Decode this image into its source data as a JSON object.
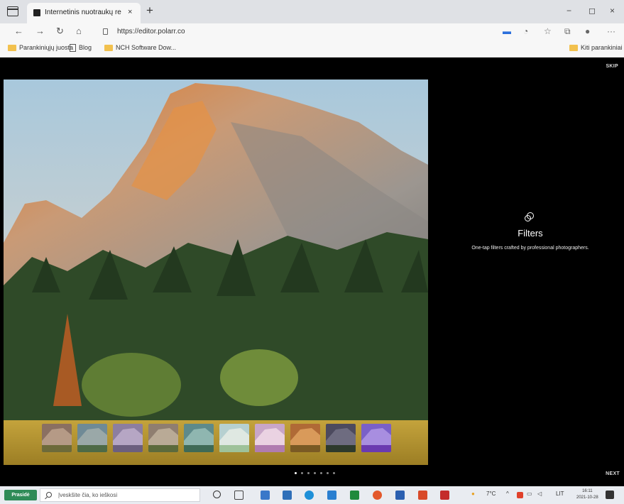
{
  "browser": {
    "tab_title": "Internetinis nuotraukų redagavi",
    "tab_close": "×",
    "new_tab": "+",
    "window_controls": [
      "−",
      "◻",
      "×"
    ],
    "address": "https://editor.polarr.co",
    "toolbar_icons": [
      "back-icon",
      "forward-icon",
      "refresh-icon",
      "home-icon",
      "lock-icon"
    ],
    "bookmarks": [
      {
        "label": "Parankiniųjų juosta",
        "icon": "folder-icon"
      },
      {
        "label": "Blog",
        "icon": "page-icon"
      },
      {
        "label": "NCH Software Dow...",
        "icon": "folder-icon"
      }
    ],
    "other_bookmarks": "Kiti parankiniai"
  },
  "onboarding": {
    "skip_label": "SKIP",
    "next_label": "NEXT",
    "feature_icon": "filters-icon",
    "feature_title": "Filters",
    "feature_description": "One-tap filters crafted by professional photographers.",
    "dots_total": 7,
    "dot_active": 0,
    "filter_count": 10
  },
  "taskbar": {
    "start_label": "Prasidė",
    "search_placeholder": "Įveskšite čia, ko ieškosi",
    "clock_time": "16:11",
    "clock_date": "2021-10-28",
    "lang": "LIT"
  },
  "colors": {
    "accent": "#000000",
    "weather": "#2e8b57",
    "folder": "#f2c14e"
  }
}
